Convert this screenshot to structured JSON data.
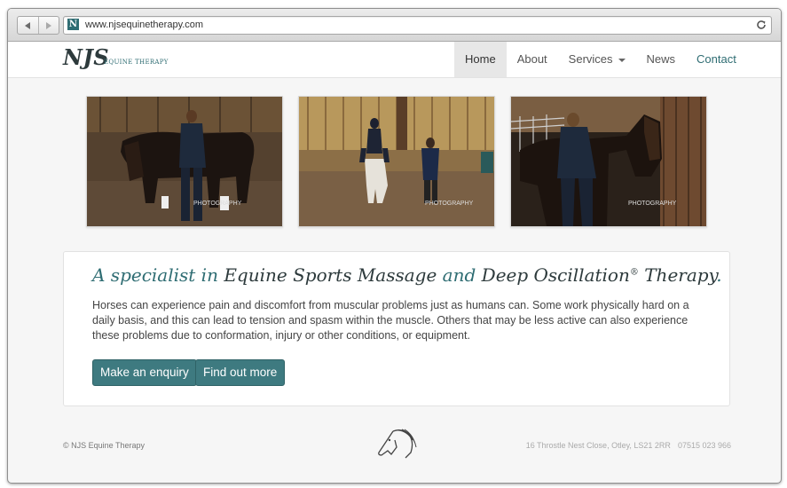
{
  "browser": {
    "url": "www.njsequinetherapy.com",
    "favicon_letter": "N"
  },
  "header": {
    "logo_main": "NJS",
    "logo_sub": "EQUINE THERAPY",
    "nav": [
      {
        "label": "Home",
        "active": true
      },
      {
        "label": "About"
      },
      {
        "label": "Services",
        "has_dropdown": true
      },
      {
        "label": "News"
      },
      {
        "label": "Contact"
      }
    ]
  },
  "photos": [
    {
      "watermark": "PHOTOGRAPHY"
    },
    {
      "watermark": "PHOTOGRAPHY"
    },
    {
      "watermark": "PHOTOGRAPHY"
    }
  ],
  "hero": {
    "headline_part1": "A specialist in ",
    "headline_part2": "Equine Sports Massage",
    "headline_part3": " and ",
    "headline_part4": "Deep Oscillation",
    "headline_sup": "®",
    "headline_part5": " Therapy",
    "headline_part6": ".",
    "body": "Horses can experience pain and discomfort from muscular problems just as humans can. Some work physically hard on a daily basis, and this can lead to tension and spasm within the muscle. Others that may be less active can also experience these problems due to conformation, injury or other conditions, or equipment.",
    "button_enquiry": "Make an enquiry",
    "button_more": "Find out more"
  },
  "footer": {
    "copyright": "© NJS Equine Therapy",
    "address": "16 Throstle Nest Close, Otley, LS21 2RR",
    "phone": "07515 023 966"
  },
  "colors": {
    "accent": "#2f6d73",
    "button": "#3e7a80",
    "text": "#2d3a3c"
  }
}
